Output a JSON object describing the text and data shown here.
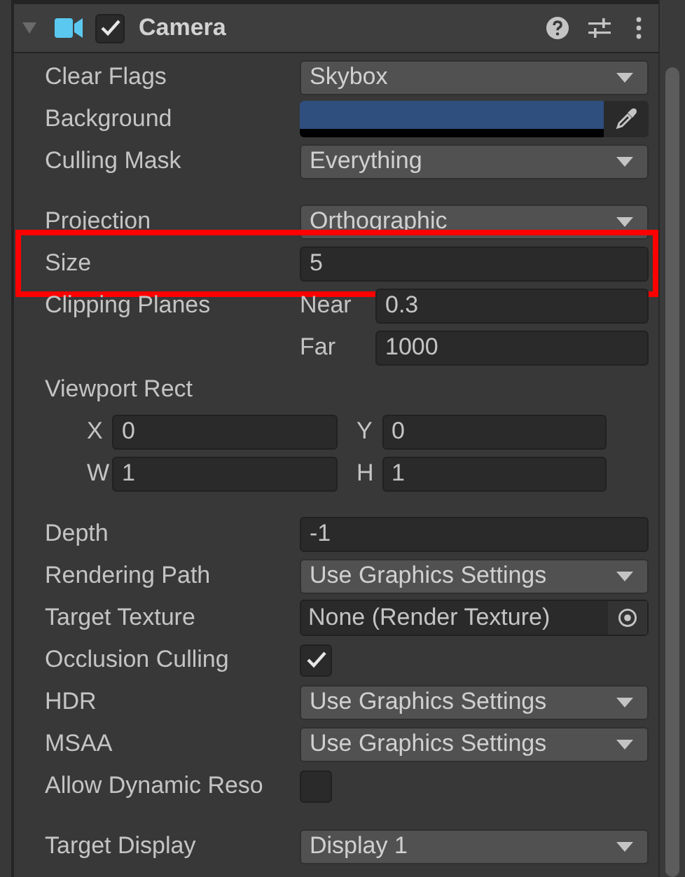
{
  "component": {
    "title": "Camera",
    "expanded": true,
    "enabled": true
  },
  "groups": [
    {
      "properties": [
        {
          "kind": "dropdown",
          "label": "Clear Flags",
          "value": "Skybox",
          "highlighted": false
        },
        {
          "kind": "color",
          "label": "Background",
          "color": "#2f4f7f",
          "highlighted": false
        },
        {
          "kind": "dropdown",
          "label": "Culling Mask",
          "value": "Everything",
          "highlighted": false
        }
      ]
    },
    {
      "properties": [
        {
          "kind": "dropdown",
          "label": "Projection",
          "value": "Orthographic",
          "highlighted": false
        },
        {
          "kind": "text",
          "label": "Size",
          "value": "5",
          "highlighted": true
        },
        {
          "kind": "pair",
          "label": "Clipping Planes",
          "fields": [
            {
              "label": "Near",
              "value": "0.3"
            },
            {
              "label": "Far",
              "value": "1000"
            }
          ],
          "highlighted": false
        },
        {
          "kind": "vector",
          "label": "Viewport Rect",
          "rows": [
            [
              {
                "label": "X",
                "value": "0"
              },
              {
                "label": "Y",
                "value": "0"
              }
            ],
            [
              {
                "label": "W",
                "value": "1"
              },
              {
                "label": "H",
                "value": "1"
              }
            ]
          ],
          "highlighted": false
        }
      ]
    },
    {
      "properties": [
        {
          "kind": "text",
          "label": "Depth",
          "value": "-1",
          "highlighted": false
        },
        {
          "kind": "dropdown",
          "label": "Rendering Path",
          "value": "Use Graphics Settings",
          "highlighted": false
        },
        {
          "kind": "object",
          "label": "Target Texture",
          "value": "None (Render Texture)",
          "highlighted": false
        },
        {
          "kind": "toggle",
          "label": "Occlusion Culling",
          "checked": true,
          "highlighted": false
        },
        {
          "kind": "dropdown",
          "label": "HDR",
          "value": "Use Graphics Settings",
          "highlighted": false
        },
        {
          "kind": "dropdown",
          "label": "MSAA",
          "value": "Use Graphics Settings",
          "highlighted": false
        },
        {
          "kind": "toggle",
          "label": "Allow Dynamic Reso",
          "checked": false,
          "highlighted": false
        }
      ]
    },
    {
      "properties": [
        {
          "kind": "dropdown",
          "label": "Target Display",
          "value": "Display 1",
          "highlighted": false
        }
      ]
    }
  ]
}
